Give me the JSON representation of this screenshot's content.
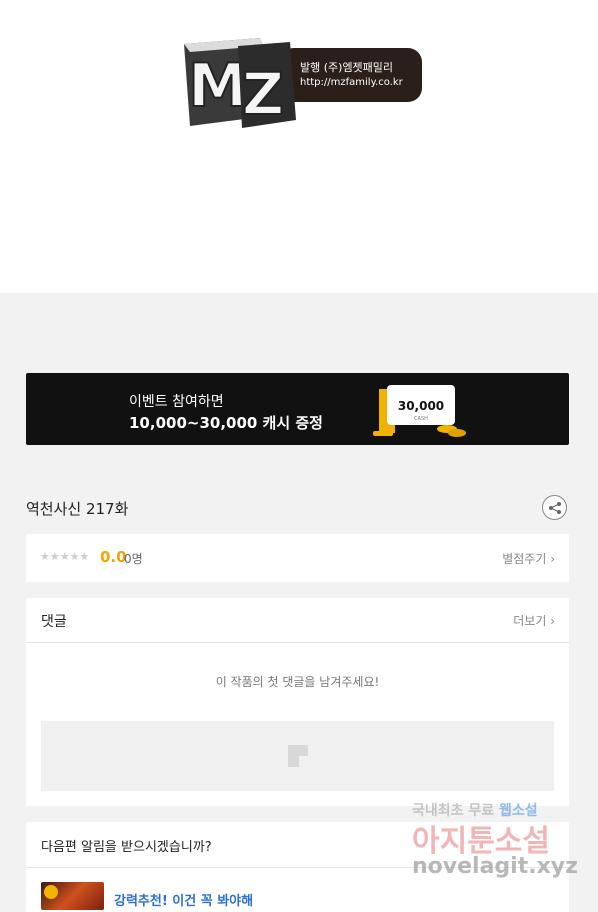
{
  "logo": {
    "publisher": "발행 (주)엠젯패밀리",
    "url": "http://mzfamily.co.kr"
  },
  "banner": {
    "line1": "이벤트 참여하면",
    "line2": "10,000~30,000 캐시 증정",
    "cash_amount": "30,000",
    "cash_label": "CASH"
  },
  "episode": {
    "title": "역천사신 217화"
  },
  "rating": {
    "stars": "★★★★★",
    "score": "0.0",
    "count": "0명",
    "rate_link": "별점주기 ›"
  },
  "comments": {
    "title": "댓글",
    "more_link": "더보기 ›",
    "empty_message": "이 작품의 첫 댓글을 남겨주세요!"
  },
  "notify": {
    "title": "다음편 알림을 받으시겠습니까?",
    "recommend": "강력추천! 이건 꼭 봐야해"
  },
  "watermark": {
    "line1_a": "국내최초 무료 ",
    "line1_b": "웹소설",
    "line2": "아지툰소설",
    "line3": "novelagit.xyz"
  },
  "colors": {
    "accent_score": "#f5a100",
    "link_blue": "#2b6fd6",
    "banner_bg": "#111111"
  }
}
